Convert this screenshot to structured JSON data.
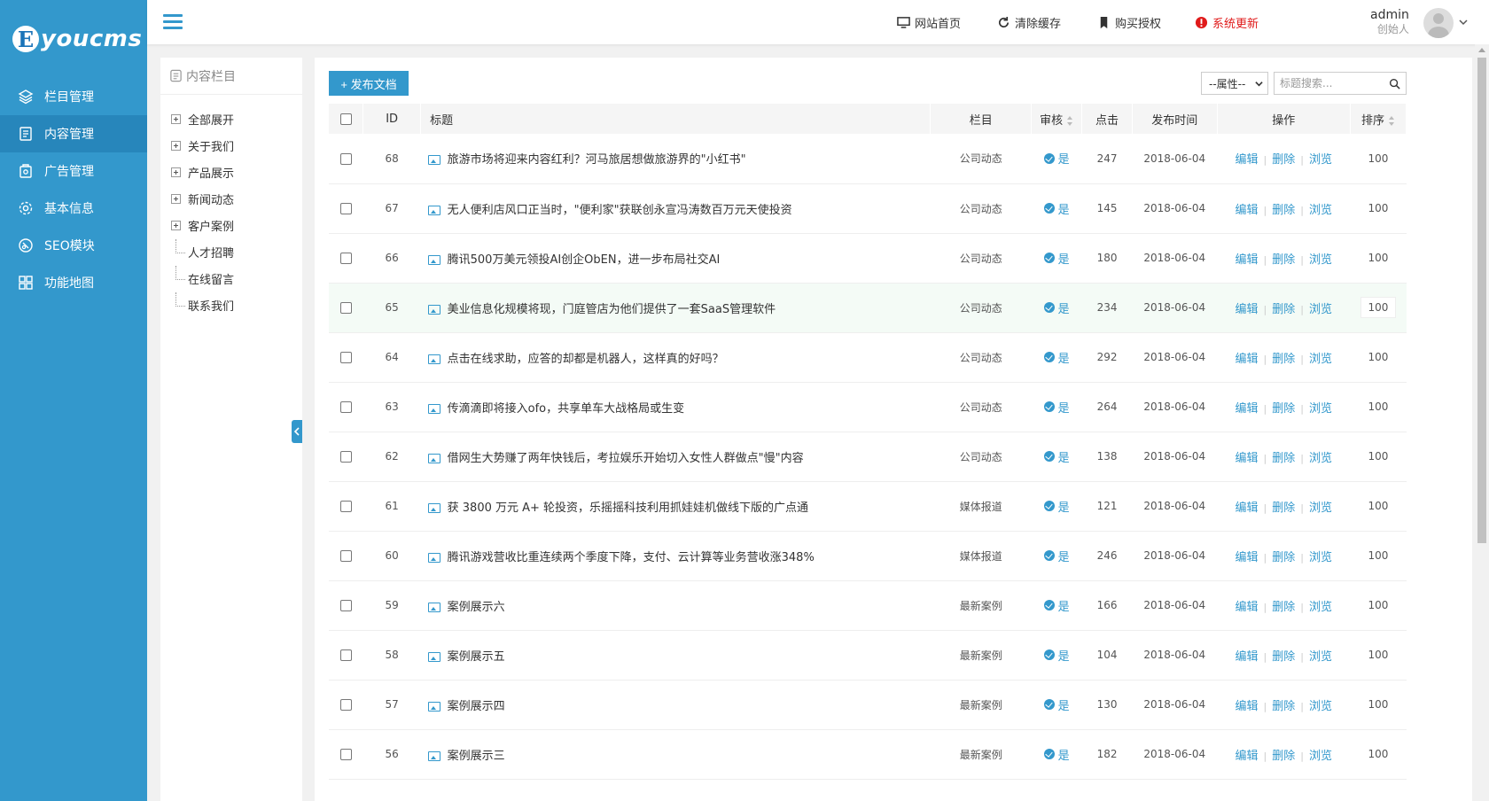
{
  "logo": {
    "mark": "E",
    "text": "youcms"
  },
  "sidebar": {
    "items": [
      {
        "label": "栏目管理",
        "icon": "layers-icon"
      },
      {
        "label": "内容管理",
        "icon": "document-icon"
      },
      {
        "label": "广告管理",
        "icon": "ad-icon"
      },
      {
        "label": "基本信息",
        "icon": "gear-icon"
      },
      {
        "label": "SEO模块",
        "icon": "seo-icon"
      },
      {
        "label": "功能地图",
        "icon": "grid-icon"
      }
    ],
    "active_index": 1
  },
  "header": {
    "links": [
      {
        "label": "网站首页",
        "icon": "monitor-icon"
      },
      {
        "label": "清除缓存",
        "icon": "refresh-icon"
      },
      {
        "label": "购买授权",
        "icon": "bookmark-icon"
      },
      {
        "label": "系统更新",
        "icon": "alert-icon"
      }
    ],
    "user": {
      "name": "admin",
      "role": "创始人"
    }
  },
  "tree": {
    "title": "内容栏目",
    "items": [
      {
        "label": "全部展开",
        "type": "plus"
      },
      {
        "label": "关于我们",
        "type": "plus"
      },
      {
        "label": "产品展示",
        "type": "plus"
      },
      {
        "label": "新闻动态",
        "type": "plus"
      },
      {
        "label": "客户案例",
        "type": "plus"
      },
      {
        "label": "人才招聘",
        "type": "leaf"
      },
      {
        "label": "在线留言",
        "type": "leaf"
      },
      {
        "label": "联系我们",
        "type": "leaf"
      }
    ]
  },
  "toolbar": {
    "publish_label": "+ 发布文档",
    "attr_select": "--属性--",
    "search_placeholder": "标题搜索..."
  },
  "table": {
    "headers": {
      "id": "ID",
      "title": "标题",
      "category": "栏目",
      "audit": "审核",
      "clicks": "点击",
      "date": "发布时间",
      "ops": "操作",
      "sort": "排序"
    },
    "ops_labels": {
      "edit": "编辑",
      "delete": "删除",
      "view": "浏览"
    },
    "rows": [
      {
        "id": "68",
        "title": "旅游市场将迎来内容红利？河马旅居想做旅游界的\"小红书\"",
        "category": "公司动态",
        "audit": "是",
        "clicks": "247",
        "date": "2018-06-04",
        "sort": "100"
      },
      {
        "id": "67",
        "title": "无人便利店风口正当时，\"便利家\"获联创永宣冯涛数百万元天使投资",
        "category": "公司动态",
        "audit": "是",
        "clicks": "145",
        "date": "2018-06-04",
        "sort": "100"
      },
      {
        "id": "66",
        "title": "腾讯500万美元领投AI创企ObEN，进一步布局社交AI",
        "category": "公司动态",
        "audit": "是",
        "clicks": "180",
        "date": "2018-06-04",
        "sort": "100"
      },
      {
        "id": "65",
        "title": "美业信息化规模将现，门庭管店为他们提供了一套SaaS管理软件",
        "category": "公司动态",
        "audit": "是",
        "clicks": "234",
        "date": "2018-06-04",
        "sort": "100"
      },
      {
        "id": "64",
        "title": "点击在线求助，应答的却都是机器人，这样真的好吗？",
        "category": "公司动态",
        "audit": "是",
        "clicks": "292",
        "date": "2018-06-04",
        "sort": "100"
      },
      {
        "id": "63",
        "title": "传滴滴即将接入ofo，共享单车大战格局或生变",
        "category": "公司动态",
        "audit": "是",
        "clicks": "264",
        "date": "2018-06-04",
        "sort": "100"
      },
      {
        "id": "62",
        "title": "借网生大势赚了两年快钱后，考拉娱乐开始切入女性人群做点\"慢\"内容",
        "category": "公司动态",
        "audit": "是",
        "clicks": "138",
        "date": "2018-06-04",
        "sort": "100"
      },
      {
        "id": "61",
        "title": "获 3800 万元 A+ 轮投资，乐摇摇科技利用抓娃娃机做线下版的广点通",
        "category": "媒体报道",
        "audit": "是",
        "clicks": "121",
        "date": "2018-06-04",
        "sort": "100"
      },
      {
        "id": "60",
        "title": "腾讯游戏营收比重连续两个季度下降，支付、云计算等业务营收涨348%",
        "category": "媒体报道",
        "audit": "是",
        "clicks": "246",
        "date": "2018-06-04",
        "sort": "100"
      },
      {
        "id": "59",
        "title": "案例展示六",
        "category": "最新案例",
        "audit": "是",
        "clicks": "166",
        "date": "2018-06-04",
        "sort": "100"
      },
      {
        "id": "58",
        "title": "案例展示五",
        "category": "最新案例",
        "audit": "是",
        "clicks": "104",
        "date": "2018-06-04",
        "sort": "100"
      },
      {
        "id": "57",
        "title": "案例展示四",
        "category": "最新案例",
        "audit": "是",
        "clicks": "130",
        "date": "2018-06-04",
        "sort": "100"
      },
      {
        "id": "56",
        "title": "案例展示三",
        "category": "最新案例",
        "audit": "是",
        "clicks": "182",
        "date": "2018-06-04",
        "sort": "100"
      }
    ],
    "highlight_index": 3
  }
}
